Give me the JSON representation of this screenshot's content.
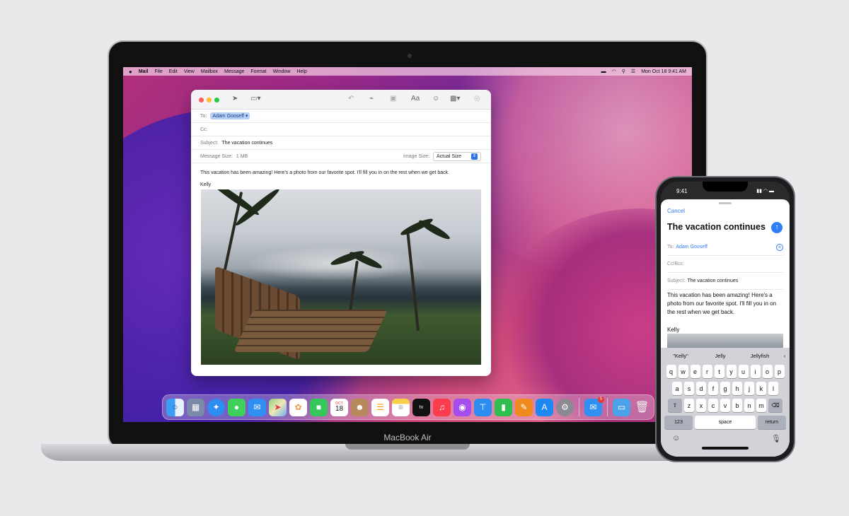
{
  "mac": {
    "label": "MacBook Air",
    "menubar": {
      "apple": "",
      "app": "Mail",
      "items": [
        "File",
        "Edit",
        "View",
        "Mailbox",
        "Message",
        "Format",
        "Window",
        "Help"
      ],
      "datetime": "Mon Oct 18  9:41 AM",
      "status_icons": [
        "battery-icon",
        "wifi-icon",
        "search-icon",
        "control-center-icon"
      ]
    },
    "mail": {
      "to_label": "To:",
      "to_value": "Adam Gooseff ▾",
      "cc_label": "Cc:",
      "subject_label": "Subject:",
      "subject_value": "The vacation continues",
      "size_label": "Message Size:",
      "size_value": "1 MB",
      "image_size_label": "Image Size:",
      "image_size_value": "Actual Size",
      "body": "This vacation has been amazing! Here's a photo from our favorite spot. I'll fill you in on the rest when we get back.",
      "signature": "Kelly",
      "toolbar_icons": [
        "send-icon",
        "header-fields-icon",
        "reply-icon",
        "attach-icon",
        "markup-icon",
        "format-icon",
        "emoji-icon",
        "photo-browser-icon",
        "hide-my-email-icon"
      ]
    },
    "dock": {
      "apps": [
        "finder",
        "launchpad",
        "safari",
        "messages",
        "mail",
        "maps",
        "photos",
        "facetime",
        "calendar",
        "contacts",
        "reminders",
        "notes",
        "tv",
        "music",
        "podcasts",
        "keynote",
        "numbers",
        "pages",
        "app-store",
        "system-preferences",
        "mail-2",
        "downloads",
        "trash"
      ],
      "calendar_month": "OCT",
      "calendar_day": "18",
      "mail_badge": "5"
    }
  },
  "phone": {
    "time": "9:41",
    "cancel": "Cancel",
    "title": "The vacation continues",
    "to_label": "To:",
    "to_value": "Adam Gooseff",
    "cc_label": "Cc/Bcc:",
    "subject_label": "Subject:",
    "subject_value": "The vacation continues",
    "body": "This vacation has been amazing! Here's a photo from our favorite spot. I'll fill you in on the rest when we get back.",
    "signature": "Kelly",
    "keyboard": {
      "suggestions": [
        "\"Kelly\"",
        "Jelly",
        "Jellyfish"
      ],
      "row1": [
        "q",
        "w",
        "e",
        "r",
        "t",
        "y",
        "u",
        "i",
        "o",
        "p"
      ],
      "row2": [
        "a",
        "s",
        "d",
        "f",
        "g",
        "h",
        "j",
        "k",
        "l"
      ],
      "row3": [
        "z",
        "x",
        "c",
        "v",
        "b",
        "n",
        "m"
      ],
      "num_key": "123",
      "space_key": "space",
      "return_key": "return"
    }
  }
}
